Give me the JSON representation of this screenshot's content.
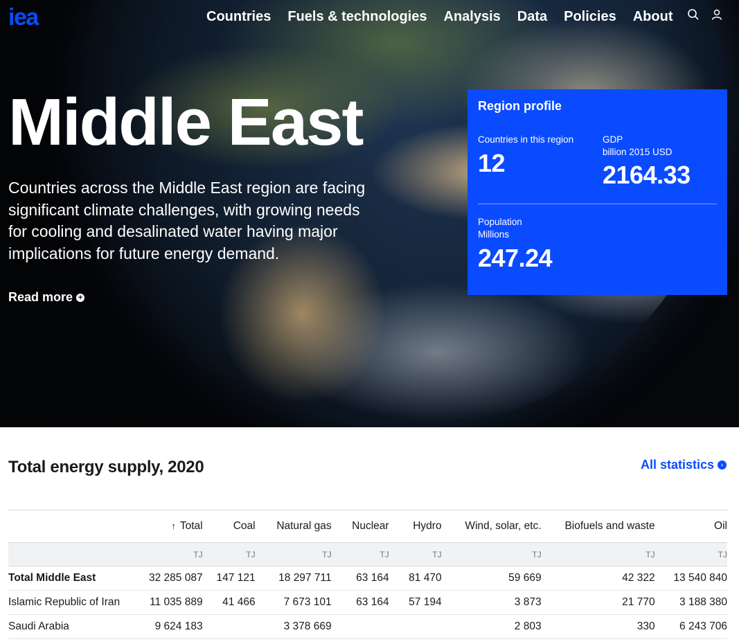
{
  "nav": {
    "logo": "iea",
    "items": [
      "Countries",
      "Fuels & technologies",
      "Analysis",
      "Data",
      "Policies",
      "About"
    ],
    "icons": [
      "search-icon",
      "user-icon"
    ]
  },
  "hero": {
    "title": "Middle East",
    "description": "Countries across the Middle East region are facing significant climate challenges, with growing needs for cooling and desalinated water having major implications for future energy demand.",
    "read_more": "Read more"
  },
  "profile": {
    "title": "Region profile",
    "countries_label": "Countries in this region",
    "countries_value": "12",
    "gdp_label": "GDP",
    "gdp_unit": "billion 2015 USD",
    "gdp_value": "2164.33",
    "population_label": "Population",
    "population_unit": "Millions",
    "population_value": "247.24",
    "color": "#0a4bff"
  },
  "stats": {
    "title": "Total energy supply, 2020",
    "all_statistics": "All statistics",
    "sort_indicator": "↑",
    "columns": [
      "",
      "Total",
      "Coal",
      "Natural gas",
      "Nuclear",
      "Hydro",
      "Wind, solar, etc.",
      "Biofuels and waste",
      "Oil"
    ],
    "units": [
      "",
      "TJ",
      "TJ",
      "TJ",
      "TJ",
      "TJ",
      "TJ",
      "TJ",
      "TJ"
    ],
    "rows": [
      [
        "Total Middle East",
        "32 285 087",
        "147 121",
        "18 297 711",
        "63 164",
        "81 470",
        "59 669",
        "42 322",
        "13 540 840"
      ],
      [
        "Islamic Republic of Iran",
        "11 035 889",
        "41 466",
        "7 673 101",
        "63 164",
        "57 194",
        "3 873",
        "21 770",
        "3 188 380"
      ],
      [
        "Saudi Arabia",
        "9 624 183",
        "",
        "3 378 669",
        "",
        "",
        "2 803",
        "330",
        "6 243 706"
      ]
    ]
  }
}
